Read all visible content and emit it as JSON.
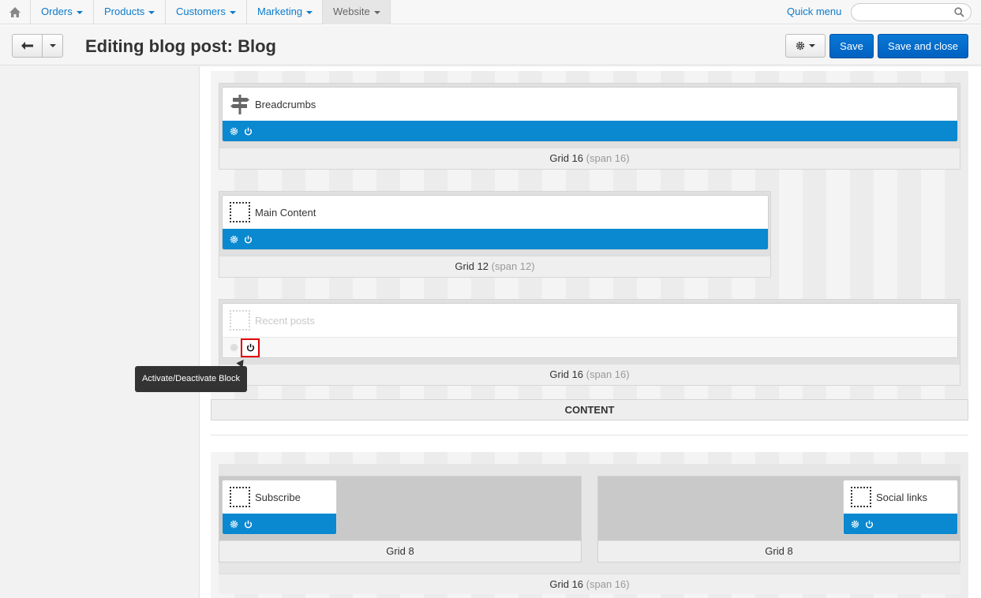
{
  "nav": {
    "home_icon": "home-icon",
    "items": [
      {
        "label": "Orders"
      },
      {
        "label": "Products"
      },
      {
        "label": "Customers"
      },
      {
        "label": "Marketing"
      },
      {
        "label": "Website"
      }
    ],
    "quick_menu": "Quick menu",
    "search_placeholder": ""
  },
  "header": {
    "title": "Editing blog post: Blog",
    "save_label": "Save",
    "save_close_label": "Save and close"
  },
  "layout": {
    "content_label": "CONTENT",
    "grids": [
      {
        "label": "Grid 16",
        "span": "(span 16)",
        "block": {
          "name": "Breadcrumbs",
          "icon": "breadcrumbs-signpost-icon",
          "active": true
        }
      },
      {
        "label": "Grid 12",
        "span": "(span 12)",
        "block": {
          "name": "Main Content",
          "icon": "placeholder-icon",
          "active": true
        }
      },
      {
        "label": "Grid 16",
        "span": "(span 16)",
        "block": {
          "name": "Recent posts",
          "icon": "placeholder-icon",
          "active": false
        }
      }
    ],
    "footer_grids": [
      {
        "label": "Grid 8",
        "block": {
          "name": "Subscribe",
          "active": true
        }
      },
      {
        "label": "Grid 8",
        "block": {
          "name": "Social links",
          "active": true
        }
      }
    ],
    "footer_parent": {
      "label": "Grid 16",
      "span": "(span 16)"
    }
  },
  "tooltip": "Activate/Deactivate Block",
  "colors": {
    "accent": "#0b7bcb",
    "block_bar": "#0a88d0",
    "primary_button": "#0a78d6",
    "highlight": "#e00000"
  }
}
